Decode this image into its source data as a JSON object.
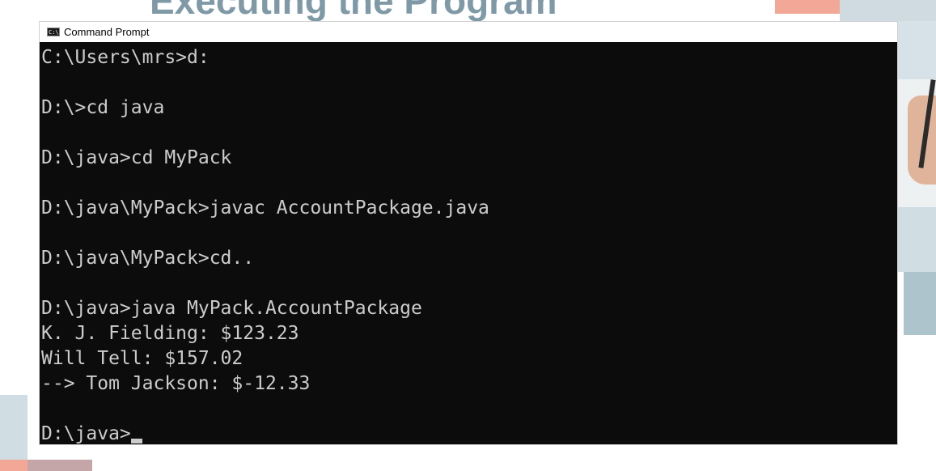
{
  "slide": {
    "title": "Executing the Program"
  },
  "window": {
    "title": "Command Prompt",
    "icon": "command-prompt-icon",
    "icon_text": "C:\\"
  },
  "console": {
    "lines": [
      "C:\\Users\\mrs>d:",
      "",
      "D:\\>cd java",
      "",
      "D:\\java>cd MyPack",
      "",
      "D:\\java\\MyPack>javac AccountPackage.java",
      "",
      "D:\\java\\MyPack>cd..",
      "",
      "D:\\java>java MyPack.AccountPackage",
      "K. J. Fielding: $123.23",
      "Will Tell: $157.02",
      "--> Tom Jackson: $-12.33",
      "",
      "D:\\java>"
    ]
  },
  "colors": {
    "console_bg": "#0c0c0c",
    "console_text": "#cccccc",
    "title_color": "#7f9aa6",
    "accent_salmon": "#f3a797",
    "accent_gray_blue": "#aec4cd"
  }
}
